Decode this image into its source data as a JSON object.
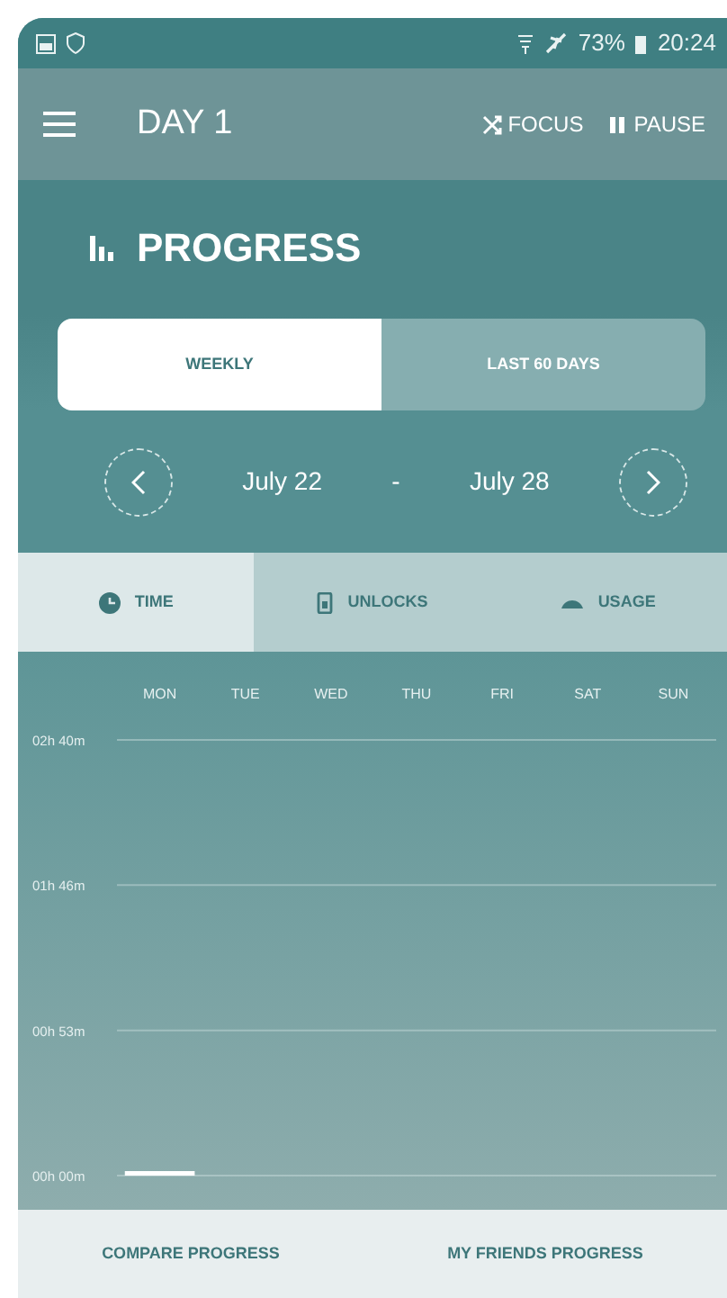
{
  "status_bar": {
    "battery": "73%",
    "time": "20:24"
  },
  "app_bar": {
    "title": "DAY 1",
    "actions": [
      {
        "label": "FOCUS",
        "kind": "focus"
      },
      {
        "label": "PAUSE",
        "kind": "pause"
      }
    ]
  },
  "header": {
    "title": "PROGRESS"
  },
  "period_toggle": [
    {
      "label": "WEEKLY",
      "selected": true
    },
    {
      "label": "LAST 60 DAYS",
      "selected": false
    }
  ],
  "date_range": {
    "start": "July 22",
    "separator": "-",
    "end": "July 28"
  },
  "metric_tabs": [
    {
      "label": "TIME",
      "kind": "time",
      "selected": true
    },
    {
      "label": "UNLOCKS",
      "kind": "unlocks",
      "selected": false
    },
    {
      "label": "USAGE",
      "kind": "usage",
      "selected": false
    }
  ],
  "chart": {
    "day_labels": [
      "MON",
      "TUE",
      "WED",
      "THU",
      "FRI",
      "SAT",
      "SUN"
    ],
    "y_labels": [
      "02h 40m",
      "01h 46m",
      "00h 53m",
      "00h 00m"
    ]
  },
  "footer": {
    "buttons": [
      "COMPARE PROGRESS",
      "MY FRIENDS PROGRESS"
    ]
  }
}
